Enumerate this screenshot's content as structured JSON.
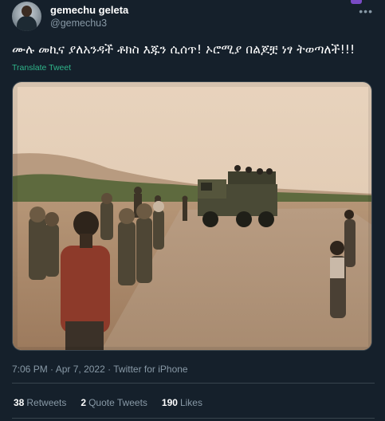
{
  "author": {
    "display_name": "gemechu geleta",
    "handle": "@gemechu3"
  },
  "tweet": {
    "text": "ሙሉ መኪና ያለአንዳች ቶክስ እጁን ሲሰጥ! ኦሮሚያ በልጆቿ ነፃ ትወጣለች!!!",
    "translate_label": "Translate Tweet",
    "time": "7:06 PM",
    "date": "Apr 7, 2022",
    "source": "Twitter for iPhone",
    "separator": "·"
  },
  "stats": {
    "retweets_count": "38",
    "retweets_label": "Retweets",
    "quotes_count": "2",
    "quotes_label": "Quote Tweets",
    "likes_count": "190",
    "likes_label": "Likes"
  },
  "icons": {
    "more": "more-options-icon"
  },
  "colors": {
    "background": "#15202b",
    "secondary_text": "#8899a6",
    "link": "#2fb58a",
    "border": "#38444d"
  }
}
